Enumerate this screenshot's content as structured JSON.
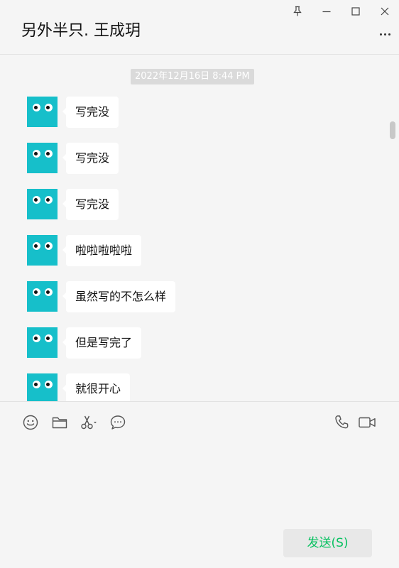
{
  "window": {
    "controls": [
      {
        "name": "pin",
        "icon": "pin-icon"
      },
      {
        "name": "minimize",
        "icon": "minimize-icon"
      },
      {
        "name": "maximize",
        "icon": "maximize-icon"
      },
      {
        "name": "close",
        "icon": "close-icon"
      }
    ]
  },
  "header": {
    "title": "另外半只. 王成玥",
    "more_icon": "more-dots-icon"
  },
  "chat": {
    "timestamp": "2022年12月16日 8:44 PM",
    "messages": [
      {
        "sender": "contact",
        "text": "写完没"
      },
      {
        "sender": "contact",
        "text": "写完没"
      },
      {
        "sender": "contact",
        "text": "写完没"
      },
      {
        "sender": "contact",
        "text": "啦啦啦啦啦"
      },
      {
        "sender": "contact",
        "text": "虽然写的不怎么样"
      },
      {
        "sender": "contact",
        "text": "但是写完了"
      },
      {
        "sender": "contact",
        "text": "就很开心"
      }
    ]
  },
  "toolbar": {
    "tools": [
      {
        "name": "emoji",
        "icon": "emoji-icon"
      },
      {
        "name": "file",
        "icon": "folder-icon"
      },
      {
        "name": "screenshot",
        "icon": "scissors-icon"
      },
      {
        "name": "chat-history",
        "icon": "chat-bubble-icon"
      },
      {
        "name": "voice-call",
        "icon": "phone-icon"
      },
      {
        "name": "video-call",
        "icon": "video-icon"
      }
    ]
  },
  "composer": {
    "input_value": "",
    "send_label": "发送(S)"
  },
  "colors": {
    "background": "#f5f5f5",
    "bubble": "#ffffff",
    "avatar": "#16bfca",
    "send_text": "#07c160",
    "timestamp_bg": "#dadada"
  }
}
